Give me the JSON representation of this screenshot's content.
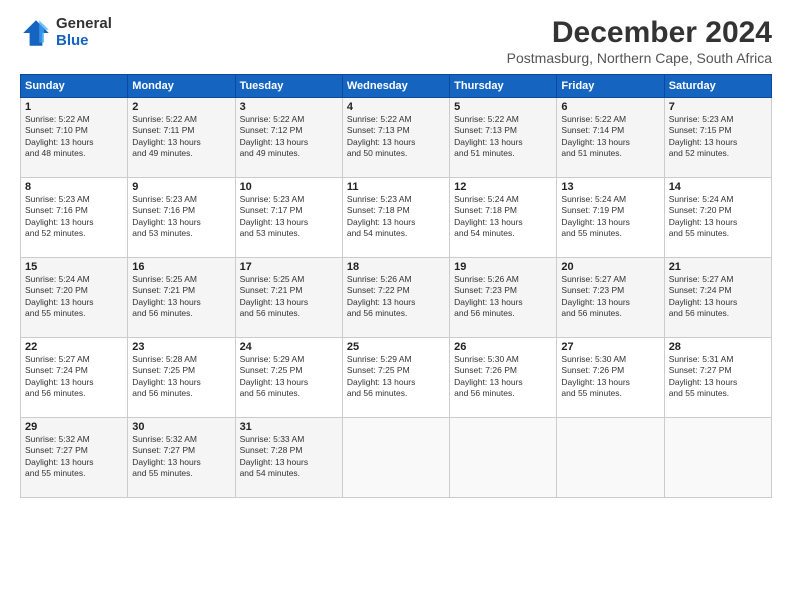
{
  "logo": {
    "general": "General",
    "blue": "Blue"
  },
  "title": "December 2024",
  "subtitle": "Postmasburg, Northern Cape, South Africa",
  "weekdays": [
    "Sunday",
    "Monday",
    "Tuesday",
    "Wednesday",
    "Thursday",
    "Friday",
    "Saturday"
  ],
  "weeks": [
    [
      {
        "day": "1",
        "info": "Sunrise: 5:22 AM\nSunset: 7:10 PM\nDaylight: 13 hours\nand 48 minutes."
      },
      {
        "day": "2",
        "info": "Sunrise: 5:22 AM\nSunset: 7:11 PM\nDaylight: 13 hours\nand 49 minutes."
      },
      {
        "day": "3",
        "info": "Sunrise: 5:22 AM\nSunset: 7:12 PM\nDaylight: 13 hours\nand 49 minutes."
      },
      {
        "day": "4",
        "info": "Sunrise: 5:22 AM\nSunset: 7:13 PM\nDaylight: 13 hours\nand 50 minutes."
      },
      {
        "day": "5",
        "info": "Sunrise: 5:22 AM\nSunset: 7:13 PM\nDaylight: 13 hours\nand 51 minutes."
      },
      {
        "day": "6",
        "info": "Sunrise: 5:22 AM\nSunset: 7:14 PM\nDaylight: 13 hours\nand 51 minutes."
      },
      {
        "day": "7",
        "info": "Sunrise: 5:23 AM\nSunset: 7:15 PM\nDaylight: 13 hours\nand 52 minutes."
      }
    ],
    [
      {
        "day": "8",
        "info": "Sunrise: 5:23 AM\nSunset: 7:16 PM\nDaylight: 13 hours\nand 52 minutes."
      },
      {
        "day": "9",
        "info": "Sunrise: 5:23 AM\nSunset: 7:16 PM\nDaylight: 13 hours\nand 53 minutes."
      },
      {
        "day": "10",
        "info": "Sunrise: 5:23 AM\nSunset: 7:17 PM\nDaylight: 13 hours\nand 53 minutes."
      },
      {
        "day": "11",
        "info": "Sunrise: 5:23 AM\nSunset: 7:18 PM\nDaylight: 13 hours\nand 54 minutes."
      },
      {
        "day": "12",
        "info": "Sunrise: 5:24 AM\nSunset: 7:18 PM\nDaylight: 13 hours\nand 54 minutes."
      },
      {
        "day": "13",
        "info": "Sunrise: 5:24 AM\nSunset: 7:19 PM\nDaylight: 13 hours\nand 55 minutes."
      },
      {
        "day": "14",
        "info": "Sunrise: 5:24 AM\nSunset: 7:20 PM\nDaylight: 13 hours\nand 55 minutes."
      }
    ],
    [
      {
        "day": "15",
        "info": "Sunrise: 5:24 AM\nSunset: 7:20 PM\nDaylight: 13 hours\nand 55 minutes."
      },
      {
        "day": "16",
        "info": "Sunrise: 5:25 AM\nSunset: 7:21 PM\nDaylight: 13 hours\nand 56 minutes."
      },
      {
        "day": "17",
        "info": "Sunrise: 5:25 AM\nSunset: 7:21 PM\nDaylight: 13 hours\nand 56 minutes."
      },
      {
        "day": "18",
        "info": "Sunrise: 5:26 AM\nSunset: 7:22 PM\nDaylight: 13 hours\nand 56 minutes."
      },
      {
        "day": "19",
        "info": "Sunrise: 5:26 AM\nSunset: 7:23 PM\nDaylight: 13 hours\nand 56 minutes."
      },
      {
        "day": "20",
        "info": "Sunrise: 5:27 AM\nSunset: 7:23 PM\nDaylight: 13 hours\nand 56 minutes."
      },
      {
        "day": "21",
        "info": "Sunrise: 5:27 AM\nSunset: 7:24 PM\nDaylight: 13 hours\nand 56 minutes."
      }
    ],
    [
      {
        "day": "22",
        "info": "Sunrise: 5:27 AM\nSunset: 7:24 PM\nDaylight: 13 hours\nand 56 minutes."
      },
      {
        "day": "23",
        "info": "Sunrise: 5:28 AM\nSunset: 7:25 PM\nDaylight: 13 hours\nand 56 minutes."
      },
      {
        "day": "24",
        "info": "Sunrise: 5:29 AM\nSunset: 7:25 PM\nDaylight: 13 hours\nand 56 minutes."
      },
      {
        "day": "25",
        "info": "Sunrise: 5:29 AM\nSunset: 7:25 PM\nDaylight: 13 hours\nand 56 minutes."
      },
      {
        "day": "26",
        "info": "Sunrise: 5:30 AM\nSunset: 7:26 PM\nDaylight: 13 hours\nand 56 minutes."
      },
      {
        "day": "27",
        "info": "Sunrise: 5:30 AM\nSunset: 7:26 PM\nDaylight: 13 hours\nand 55 minutes."
      },
      {
        "day": "28",
        "info": "Sunrise: 5:31 AM\nSunset: 7:27 PM\nDaylight: 13 hours\nand 55 minutes."
      }
    ],
    [
      {
        "day": "29",
        "info": "Sunrise: 5:32 AM\nSunset: 7:27 PM\nDaylight: 13 hours\nand 55 minutes."
      },
      {
        "day": "30",
        "info": "Sunrise: 5:32 AM\nSunset: 7:27 PM\nDaylight: 13 hours\nand 55 minutes."
      },
      {
        "day": "31",
        "info": "Sunrise: 5:33 AM\nSunset: 7:28 PM\nDaylight: 13 hours\nand 54 minutes."
      },
      {
        "day": "",
        "info": ""
      },
      {
        "day": "",
        "info": ""
      },
      {
        "day": "",
        "info": ""
      },
      {
        "day": "",
        "info": ""
      }
    ]
  ]
}
